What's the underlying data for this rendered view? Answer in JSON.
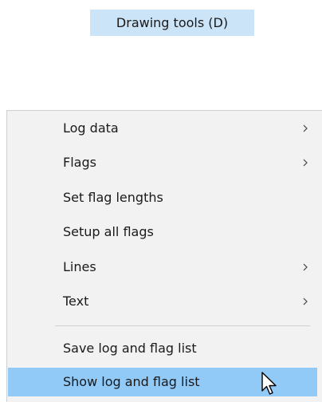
{
  "toolbar_tooltip": {
    "label": "Drawing tools (D)"
  },
  "context_menu": {
    "items": [
      {
        "label": "Log data",
        "has_submenu": true
      },
      {
        "label": "Flags",
        "has_submenu": true
      },
      {
        "label": "Set flag lengths",
        "has_submenu": false
      },
      {
        "label": "Setup all flags",
        "has_submenu": false
      },
      {
        "label": "Lines",
        "has_submenu": true
      },
      {
        "label": "Text",
        "has_submenu": true
      },
      {
        "label": "Save log and flag list",
        "has_submenu": false
      },
      {
        "label": "Show log and flag list",
        "has_submenu": false,
        "highlighted": true
      }
    ],
    "submenu_icon": "chevron-right-icon",
    "pointer_icon": "mouse-pointer-icon"
  },
  "colors": {
    "tooltip_background": "#cce4f7",
    "menu_background": "#f2f2f2",
    "highlight": "#91c9f7",
    "text": "#1a1a1a"
  }
}
